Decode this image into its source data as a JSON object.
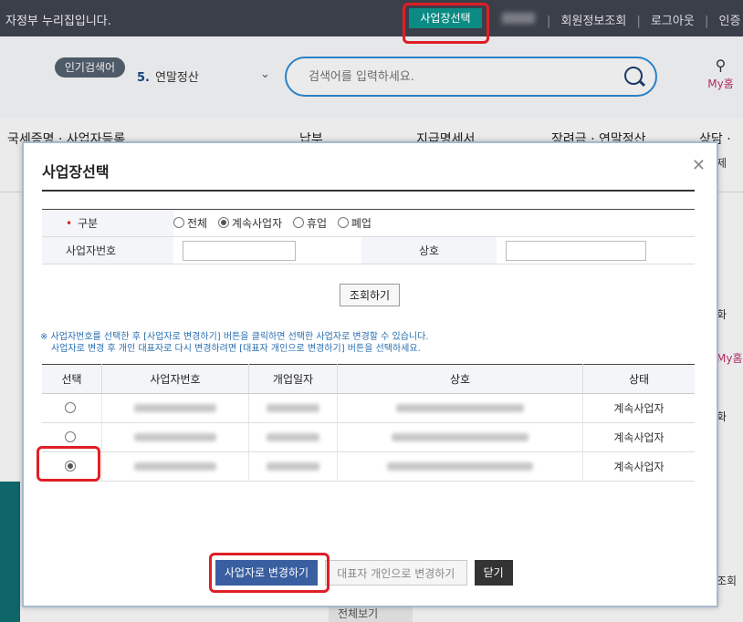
{
  "topbar": {
    "brand": "자정부 누리집입니다.",
    "biz_select": "사업장선택",
    "links": [
      "회원정보조회",
      "로그아웃",
      "인증"
    ]
  },
  "search": {
    "popular_badge": "인기검색어",
    "popular_rank": "5.",
    "popular_keyword": "연말정산",
    "placeholder": "검색어를 입력하세요.",
    "myhome": "My홈"
  },
  "nav": {
    "items": [
      "국세증명 · 사업자등록",
      "납부",
      "지급명세서",
      "장려금 · 연말정산",
      "상담 ·"
    ]
  },
  "background_fragments": {
    "right": [
      "제",
      "화",
      "My홈",
      "화",
      "조회"
    ],
    "bottom": "전체보기"
  },
  "modal": {
    "title": "사업장선택",
    "form": {
      "type_label": "구분",
      "options": [
        "전체",
        "계속사업자",
        "휴업",
        "폐업"
      ],
      "selected_option": "계속사업자",
      "bizno_label": "사업자번호",
      "name_label": "상호"
    },
    "search_button": "조회하기",
    "notice": [
      "※ 사업자번호를 선택한 후 [사업자로 변경하기] 버튼을 클릭하면 선택한 사업자로 변경할 수 있습니다.",
      "사업자로 변경 후 개인 대표자로 다시 변경하려면 [대표자 개인으로 변경하기] 버튼을 선택하세요."
    ],
    "table": {
      "headers": [
        "선택",
        "사업자번호",
        "개업일자",
        "상호",
        "상태"
      ],
      "rows": [
        {
          "status": "계속사업자",
          "selected": false
        },
        {
          "status": "계속사업자",
          "selected": false
        },
        {
          "status": "계속사업자",
          "selected": true
        }
      ]
    },
    "buttons": {
      "change_to_business": "사업자로 변경하기",
      "change_to_individual": "대표자 개인으로 변경하기",
      "close": "닫기"
    }
  },
  "colors": {
    "highlight": "#e01e26",
    "primary": "#3a5fa0",
    "topbar": "#3b3f4a",
    "biz_button": "#0c8a84"
  }
}
